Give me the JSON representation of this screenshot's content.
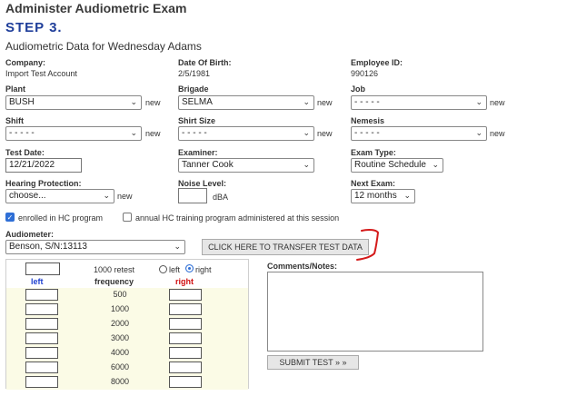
{
  "header": {
    "title": "Administer Audiometric Exam",
    "step": "STEP 3.",
    "subtitle": "Audiometric Data for Wednesday Adams"
  },
  "info": {
    "company_label": "Company:",
    "company_value": "Import Test Account",
    "dob_label": "Date Of Birth:",
    "dob_value": "2/5/1981",
    "employee_label": "Employee ID:",
    "employee_value": "990126"
  },
  "fields": {
    "plant_label": "Plant",
    "plant_value": "BUSH",
    "brigade_label": "Brigade",
    "brigade_value": "SELMA",
    "job_label": "Job",
    "job_value": "- - - - -",
    "shift_label": "Shift",
    "shift_value": "- - - - -",
    "shirt_label": "Shirt Size",
    "shirt_value": "- - - - -",
    "nemesis_label": "Nemesis",
    "nemesis_value": "- - - - -",
    "new_label": "new",
    "test_date_label": "Test Date:",
    "test_date_value": "12/21/2022",
    "examiner_label": "Examiner:",
    "examiner_value": "Tanner Cook",
    "exam_type_label": "Exam Type:",
    "exam_type_value": "Routine Schedule",
    "hearing_label": "Hearing Protection:",
    "hearing_value": "choose...",
    "noise_label": "Noise Level:",
    "noise_value": "",
    "noise_unit": "dBA",
    "next_exam_label": "Next Exam:",
    "next_exam_value": "12 months"
  },
  "checks": {
    "enrolled_label": "enrolled in HC program",
    "enrolled_checked": true,
    "annual_label": "annual HC training program administered at this session",
    "annual_checked": false
  },
  "audiometer": {
    "label": "Audiometer:",
    "value": "Benson, S/N:13113",
    "transfer_button": "CLICK HERE TO TRANSFER TEST DATA"
  },
  "test_table": {
    "retest_label": "1000 retest",
    "left_radio": "left",
    "right_radio": "right",
    "right_selected": true,
    "col_left": "left",
    "col_freq": "frequency",
    "col_right": "right",
    "frequencies": [
      "500",
      "1000",
      "2000",
      "3000",
      "4000",
      "6000",
      "8000"
    ],
    "left_color": "#1d3fcf",
    "right_color": "#d01010"
  },
  "comments": {
    "label": "Comments/Notes:",
    "value": "",
    "submit_button": "SUBMIT TEST » »"
  },
  "annotation": {
    "color": "#d41a1a"
  }
}
